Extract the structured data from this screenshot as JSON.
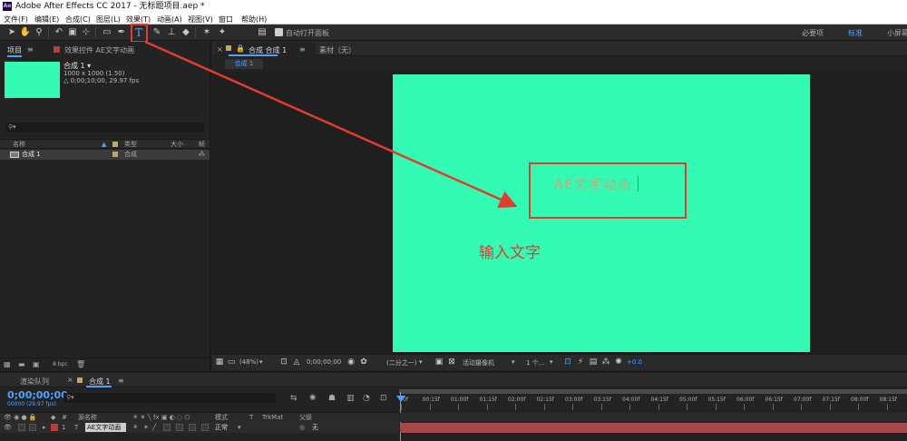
{
  "window": {
    "title": "Adobe After Effects CC 2017 - 无标题项目.aep *",
    "logo_text": "Ae"
  },
  "menubar": {
    "items": [
      "文件(F)",
      "编辑(E)",
      "合成(C)",
      "图层(L)",
      "效果(T)",
      "动画(A)",
      "视图(V)",
      "窗口",
      "帮助(H)"
    ]
  },
  "toolbar": {
    "auto_open_label": "自动打开面板",
    "workspaces": {
      "essentials": "必要项",
      "standard": "标准",
      "small_screen": "小屏幕"
    }
  },
  "project_panel": {
    "tab_label": "项目",
    "effects_tab_label": "效果控件 AE文字动画",
    "comp_name": "合成 1 ▾",
    "comp_size": "1000 x 1000 (1.50)",
    "comp_duration": "△ 0;00;10;00, 29.97 fps",
    "search_placeholder": "⚲▾",
    "columns": {
      "name": "名称",
      "type": "类型",
      "size": "大小",
      "frame": "帧"
    },
    "rows": [
      {
        "name": "合成 1",
        "type": "合成"
      }
    ],
    "bpc_label": "8 bpc"
  },
  "comp_panel": {
    "tab_label": "合成 合成 1",
    "footage_tab_label": "素材（无）",
    "breadcrumb": "合成 1",
    "layer_text": "AE文字动画",
    "annotation": "输入文字",
    "footer": {
      "zoom": "(48%)",
      "timecode": "0;00;00;00",
      "resolution": "(二分之一)",
      "camera": "活动摄像机",
      "views": "1 个...",
      "exposure": "+0.0"
    }
  },
  "timeline": {
    "render_queue_tab": "渲染队列",
    "comp_tab": "合成 1",
    "timecode": "0;00;00;00",
    "timecode_sub": "00000 (29.97 fps)",
    "search_placeholder": "⚲▾",
    "ruler_ticks": [
      "0f",
      "00:15f",
      "01:00f",
      "01:15f",
      "02:00f",
      "02:15f",
      "03:00f",
      "03:15f",
      "04:00f",
      "04:15f",
      "05:00f",
      "05:15f",
      "06:00f",
      "06:15f",
      "07:00f",
      "07:15f",
      "08:00f",
      "08:15f"
    ],
    "columns": {
      "source_name": "源名称",
      "mode": "模式",
      "t": "T",
      "trkmat": "TrkMat",
      "parent": "父级"
    },
    "layer": {
      "index": "1",
      "type_icon": "T",
      "name": "AE文字动画",
      "mode": "正常",
      "parent": "无"
    }
  },
  "colors": {
    "canvas": "#34fbb4",
    "accent_blue": "#4ea1ff",
    "annotation_red": "#e23b2f",
    "track_bar": "#a8484c",
    "label_red": "#c23a3a"
  }
}
